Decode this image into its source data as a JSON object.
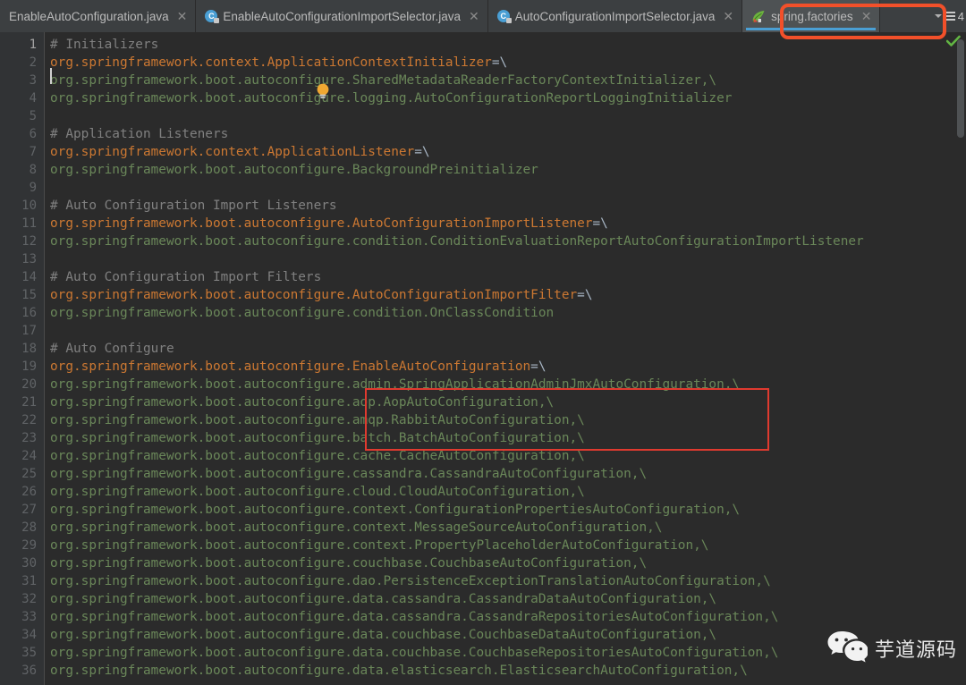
{
  "window": {
    "app": "IntelliJ IDEA Editor",
    "theme_background": "#2b2b2b",
    "gutter_background": "#313335",
    "tabbar_background": "#3c3f41",
    "active_tab_background": "#4e5254",
    "accent_underline": "#4a9fd4",
    "annotation_color": "#f2502a",
    "code_annotation_color": "#e03a2f",
    "comment_color": "#808080",
    "key_color": "#cc7832",
    "value_color": "#6a8759",
    "equals_color": "#a9b7c6"
  },
  "tabs": [
    {
      "label": "EnableAutoConfiguration.java",
      "icon": "java-class-icon",
      "show_icon": false,
      "close": "✕",
      "active": false
    },
    {
      "label": "EnableAutoConfigurationImportSelector.java",
      "icon": "java-class-icon",
      "show_icon": true,
      "close": "✕",
      "active": false
    },
    {
      "label": "AutoConfigurationImportSelector.java",
      "icon": "java-class-icon",
      "show_icon": true,
      "close": "✕",
      "active": false
    },
    {
      "label": "spring.factories",
      "icon": "spring-leaf-icon",
      "show_icon": true,
      "close": "✕",
      "active": true
    }
  ],
  "tabbar_right": {
    "chevron": "chevron-down-icon",
    "list_icon": "tab-list-icon",
    "hidden_tab_count": "4"
  },
  "inspection": {
    "status_icon": "green-check-icon",
    "status_color": "#62b543"
  },
  "editor": {
    "first_visible_line": 1,
    "caret_line": 1,
    "caret_column": 1,
    "intention_icon": "lightbulb-icon",
    "lines": [
      {
        "n": 1,
        "segments": [
          {
            "t": "# Initializers",
            "c": "c-comment"
          }
        ]
      },
      {
        "n": 2,
        "segments": [
          {
            "t": "org.springframework.context.ApplicationContextInitializer",
            "c": "c-key"
          },
          {
            "t": "=\\",
            "c": "c-eq"
          }
        ]
      },
      {
        "n": 3,
        "segments": [
          {
            "t": "org.springframework.boot.autoconfigure.SharedMetadataReaderFactoryContextInitializer,\\",
            "c": "c-val"
          }
        ]
      },
      {
        "n": 4,
        "segments": [
          {
            "t": "org.springframework.boot.autoconfigure.logging.AutoConfigurationReportLoggingInitializer",
            "c": "c-val"
          }
        ]
      },
      {
        "n": 5,
        "segments": []
      },
      {
        "n": 6,
        "segments": [
          {
            "t": "# Application Listeners",
            "c": "c-comment"
          }
        ]
      },
      {
        "n": 7,
        "segments": [
          {
            "t": "org.springframework.context.ApplicationListener",
            "c": "c-key"
          },
          {
            "t": "=\\",
            "c": "c-eq"
          }
        ]
      },
      {
        "n": 8,
        "segments": [
          {
            "t": "org.springframework.boot.autoconfigure.BackgroundPreinitializer",
            "c": "c-val"
          }
        ]
      },
      {
        "n": 9,
        "segments": []
      },
      {
        "n": 10,
        "segments": [
          {
            "t": "# Auto Configuration Import Listeners",
            "c": "c-comment"
          }
        ]
      },
      {
        "n": 11,
        "segments": [
          {
            "t": "org.springframework.boot.autoconfigure.AutoConfigurationImportListener",
            "c": "c-key"
          },
          {
            "t": "=\\",
            "c": "c-eq"
          }
        ]
      },
      {
        "n": 12,
        "segments": [
          {
            "t": "org.springframework.boot.autoconfigure.condition.ConditionEvaluationReportAutoConfigurationImportListener",
            "c": "c-val"
          }
        ]
      },
      {
        "n": 13,
        "segments": []
      },
      {
        "n": 14,
        "segments": [
          {
            "t": "# Auto Configuration Import Filters",
            "c": "c-comment"
          }
        ]
      },
      {
        "n": 15,
        "segments": [
          {
            "t": "org.springframework.boot.autoconfigure.AutoConfigurationImportFilter",
            "c": "c-key"
          },
          {
            "t": "=\\",
            "c": "c-eq"
          }
        ]
      },
      {
        "n": 16,
        "segments": [
          {
            "t": "org.springframework.boot.autoconfigure.condition.OnClassCondition",
            "c": "c-val"
          }
        ]
      },
      {
        "n": 17,
        "segments": []
      },
      {
        "n": 18,
        "segments": [
          {
            "t": "# Auto Configure",
            "c": "c-comment"
          }
        ]
      },
      {
        "n": 19,
        "segments": [
          {
            "t": "org.springframework.boot.autoconfigure.EnableAutoConfiguration",
            "c": "c-key"
          },
          {
            "t": "=\\",
            "c": "c-eq"
          }
        ]
      },
      {
        "n": 20,
        "segments": [
          {
            "t": "org.springframework.boot.autoconfigure.admin.SpringApplicationAdminJmxAutoConfiguration,\\",
            "c": "c-val"
          }
        ]
      },
      {
        "n": 21,
        "segments": [
          {
            "t": "org.springframework.boot.autoconfigure.aop.AopAutoConfiguration,\\",
            "c": "c-val"
          }
        ]
      },
      {
        "n": 22,
        "segments": [
          {
            "t": "org.springframework.boot.autoconfigure.amqp.RabbitAutoConfiguration,\\",
            "c": "c-val"
          }
        ]
      },
      {
        "n": 23,
        "segments": [
          {
            "t": "org.springframework.boot.autoconfigure.batch.BatchAutoConfiguration,\\",
            "c": "c-val"
          }
        ]
      },
      {
        "n": 24,
        "segments": [
          {
            "t": "org.springframework.boot.autoconfigure.cache.CacheAutoConfiguration,\\",
            "c": "c-val"
          }
        ]
      },
      {
        "n": 25,
        "segments": [
          {
            "t": "org.springframework.boot.autoconfigure.cassandra.CassandraAutoConfiguration,\\",
            "c": "c-val"
          }
        ]
      },
      {
        "n": 26,
        "segments": [
          {
            "t": "org.springframework.boot.autoconfigure.cloud.CloudAutoConfiguration,\\",
            "c": "c-val"
          }
        ]
      },
      {
        "n": 27,
        "segments": [
          {
            "t": "org.springframework.boot.autoconfigure.context.ConfigurationPropertiesAutoConfiguration,\\",
            "c": "c-val"
          }
        ]
      },
      {
        "n": 28,
        "segments": [
          {
            "t": "org.springframework.boot.autoconfigure.context.MessageSourceAutoConfiguration,\\",
            "c": "c-val"
          }
        ]
      },
      {
        "n": 29,
        "segments": [
          {
            "t": "org.springframework.boot.autoconfigure.context.PropertyPlaceholderAutoConfiguration,\\",
            "c": "c-val"
          }
        ]
      },
      {
        "n": 30,
        "segments": [
          {
            "t": "org.springframework.boot.autoconfigure.couchbase.CouchbaseAutoConfiguration,\\",
            "c": "c-val"
          }
        ]
      },
      {
        "n": 31,
        "segments": [
          {
            "t": "org.springframework.boot.autoconfigure.dao.PersistenceExceptionTranslationAutoConfiguration,\\",
            "c": "c-val"
          }
        ]
      },
      {
        "n": 32,
        "segments": [
          {
            "t": "org.springframework.boot.autoconfigure.data.cassandra.CassandraDataAutoConfiguration,\\",
            "c": "c-val"
          }
        ]
      },
      {
        "n": 33,
        "segments": [
          {
            "t": "org.springframework.boot.autoconfigure.data.cassandra.CassandraRepositoriesAutoConfiguration,\\",
            "c": "c-val"
          }
        ]
      },
      {
        "n": 34,
        "segments": [
          {
            "t": "org.springframework.boot.autoconfigure.data.couchbase.CouchbaseDataAutoConfiguration,\\",
            "c": "c-val"
          }
        ]
      },
      {
        "n": 35,
        "segments": [
          {
            "t": "org.springframework.boot.autoconfigure.data.couchbase.CouchbaseRepositoriesAutoConfiguration,\\",
            "c": "c-val"
          }
        ]
      },
      {
        "n": 36,
        "segments": [
          {
            "t": "org.springframework.boot.autoconfigure.data.elasticsearch.ElasticsearchAutoConfiguration,\\",
            "c": "c-val"
          }
        ]
      }
    ]
  },
  "annotations": [
    {
      "name": "tab-highlight",
      "target": "spring.factories tab",
      "color": "#f2502a"
    },
    {
      "name": "code-highlight",
      "target": "EnableAutoConfiguration entries (lines 19-21)",
      "color": "#e03a2f"
    }
  ],
  "watermark": {
    "icon": "wechat-icon",
    "text": "芋道源码"
  }
}
